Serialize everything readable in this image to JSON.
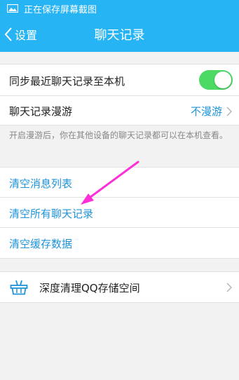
{
  "status_bar": {
    "text": "正在保存屏幕截图",
    "icon": "image-icon"
  },
  "nav": {
    "back_label": "设置",
    "title": "聊天记录"
  },
  "settings": {
    "sync": {
      "label": "同步最近聊天记录至本机",
      "enabled": true
    },
    "roaming": {
      "label": "聊天记录漫游",
      "value": "不漫游"
    },
    "hint": "开启漫游后，你在其他设备的聊天记录都可以在本机查看。"
  },
  "actions": {
    "clear_message_list": "清空消息列表",
    "clear_all_chat_history": "清空所有聊天记录",
    "clear_cache": "清空缓存数据"
  },
  "deep_clean": {
    "label": "深度清理QQ存储空间",
    "icon": "broom-basket-icon"
  },
  "colors": {
    "header": "#26b4f4",
    "link": "#1f93d9",
    "toggle_on": "#4cd964",
    "annotation_arrow": "#ff2fd8"
  }
}
